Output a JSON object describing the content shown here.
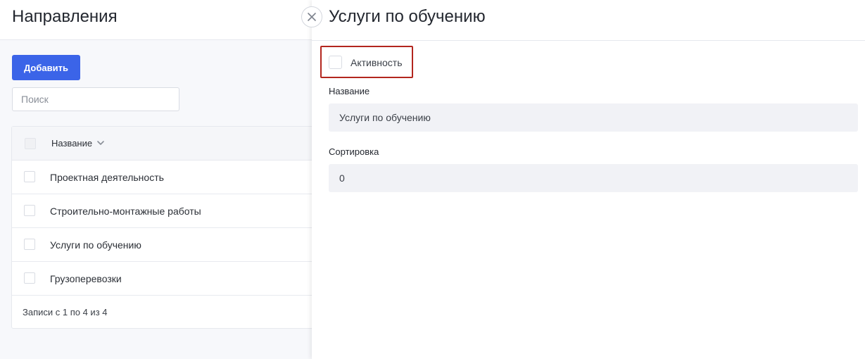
{
  "left_page": {
    "title": "Направления",
    "add_button_label": "Добавить",
    "search_placeholder": "Поиск",
    "table": {
      "column_name": "Название",
      "rows": [
        "Проектная деятельность",
        "Строительно-монтажные работы",
        "Услуги по обучению",
        "Грузоперевозки"
      ],
      "footer": "Записи с 1 по 4 из 4"
    }
  },
  "drawer": {
    "title": "Услуги по обучению",
    "activity_label": "Активность",
    "activity_checked": false,
    "fields": {
      "name_label": "Название",
      "name_value": "Услуги по обучению",
      "sort_label": "Сортировка",
      "sort_value": "0"
    }
  },
  "colors": {
    "primary": "#3b64e8",
    "highlight_border": "#b3261e",
    "input_bg": "#f1f2f6"
  },
  "icons": {
    "close": "close-icon",
    "sort": "chevron-down-icon"
  }
}
